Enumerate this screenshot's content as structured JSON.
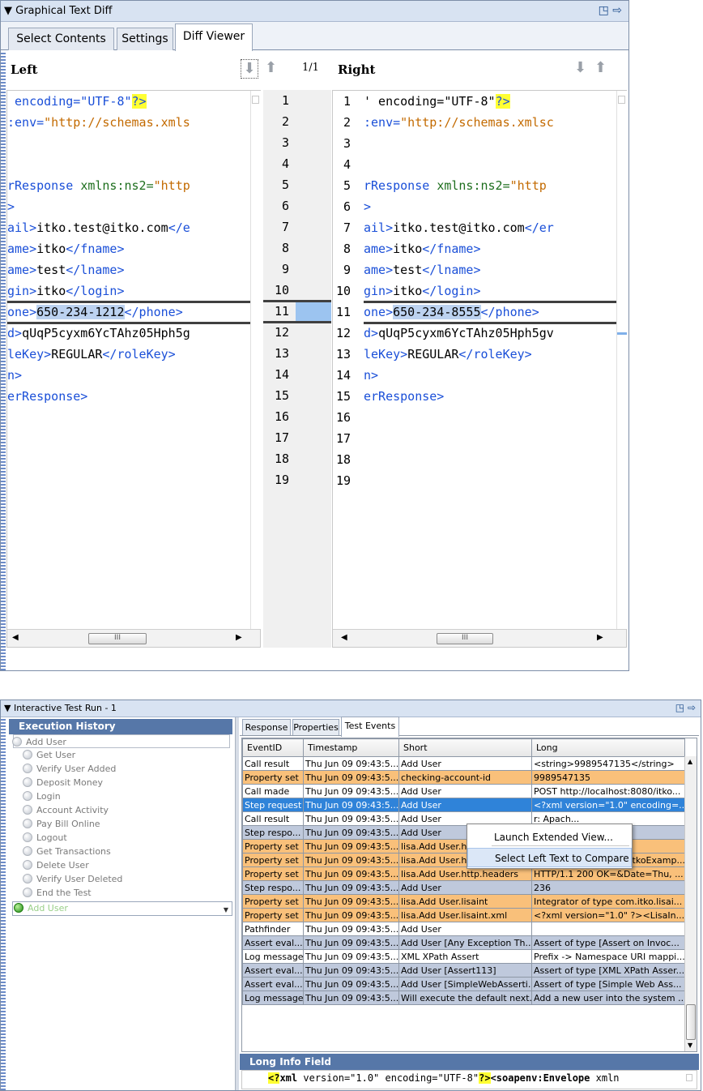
{
  "top_panel": {
    "title": "▼ Graphical Text Diff",
    "tabs": [
      "Select Contents",
      "Settings",
      "Diff Viewer"
    ],
    "left_header": "Left",
    "right_header": "Right",
    "position": "1/1",
    "left_lines": [
      [
        [
          "t",
          " encoding=\"UTF-8\""
        ],
        [
          "h",
          "?>"
        ]
      ],
      [
        [
          "t",
          ":env="
        ],
        [
          "s",
          "\"http://schemas.xmls"
        ]
      ],
      [],
      [],
      [
        [
          "t",
          "rResponse "
        ],
        [
          "a",
          "xmlns:ns2="
        ],
        [
          "s",
          "\"http"
        ]
      ],
      [
        [
          "t",
          ">"
        ]
      ],
      [
        [
          "t",
          "ail>"
        ],
        [
          "k",
          "itko.test@itko.com"
        ],
        [
          "t",
          "</e"
        ]
      ],
      [
        [
          "t",
          "ame>"
        ],
        [
          "k",
          "itko"
        ],
        [
          "t",
          "</fname>"
        ]
      ],
      [
        [
          "t",
          "ame>"
        ],
        [
          "k",
          "test"
        ],
        [
          "t",
          "</lname>"
        ]
      ],
      [
        [
          "t",
          "gin>"
        ],
        [
          "k",
          "itko"
        ],
        [
          "t",
          "</login>"
        ]
      ],
      [
        [
          "t",
          "one>"
        ],
        [
          "d",
          "650-234-1212"
        ],
        [
          "t",
          "</phone>"
        ]
      ],
      [
        [
          "t",
          "d>"
        ],
        [
          "k",
          "qUqP5cyxm6YcTAhz05Hph5g"
        ]
      ],
      [
        [
          "t",
          "leKey>"
        ],
        [
          "k",
          "REGULAR"
        ],
        [
          "t",
          "</roleKey>"
        ]
      ],
      [
        [
          "t",
          "n>"
        ]
      ],
      [
        [
          "t",
          "erResponse>"
        ]
      ],
      [],
      [],
      [],
      []
    ],
    "right_lines": [
      [
        [
          "k",
          "' encoding=\"UTF-8\""
        ],
        [
          "h",
          "?>"
        ]
      ],
      [
        [
          "t",
          ":env="
        ],
        [
          "s",
          "\"http://schemas.xmlsc"
        ]
      ],
      [],
      [],
      [
        [
          "t",
          "rResponse "
        ],
        [
          "a",
          "xmlns:ns2="
        ],
        [
          "s",
          "\"http"
        ]
      ],
      [
        [
          "t",
          ">"
        ]
      ],
      [
        [
          "t",
          "ail>"
        ],
        [
          "k",
          "itko.test@itko.com"
        ],
        [
          "t",
          "</er"
        ]
      ],
      [
        [
          "t",
          "ame>"
        ],
        [
          "k",
          "itko"
        ],
        [
          "t",
          "</fname>"
        ]
      ],
      [
        [
          "t",
          "ame>"
        ],
        [
          "k",
          "test"
        ],
        [
          "t",
          "</lname>"
        ]
      ],
      [
        [
          "t",
          "gin>"
        ],
        [
          "k",
          "itko"
        ],
        [
          "t",
          "</login>"
        ]
      ],
      [
        [
          "t",
          "one>"
        ],
        [
          "d",
          "650-234-8555"
        ],
        [
          "t",
          "</phone>"
        ]
      ],
      [
        [
          "t",
          "d>"
        ],
        [
          "k",
          "qUqP5cyxm6YcTAhz05Hph5gv"
        ]
      ],
      [
        [
          "t",
          "leKey>"
        ],
        [
          "k",
          "REGULAR"
        ],
        [
          "t",
          "</roleKey>"
        ]
      ],
      [
        [
          "t",
          "n>"
        ]
      ],
      [
        [
          "t",
          "erResponse>"
        ]
      ],
      [],
      [],
      [],
      []
    ],
    "line_numbers": [
      "1",
      "2",
      "3",
      "4",
      "5",
      "6",
      "7",
      "8",
      "9",
      "10",
      "11",
      "12",
      "13",
      "14",
      "15",
      "16",
      "17",
      "18",
      "19"
    ],
    "scroll_thumb": "III"
  },
  "bottom_panel": {
    "title": "▼ Interactive Test Run - 1",
    "execution_history_title": "Execution History",
    "steps": [
      "Add User",
      "Get User",
      "Verify User Added",
      "Deposit Money",
      "Login",
      "Account Activity",
      "Pay Bill Online",
      "Logout",
      "Get Transactions",
      "Delete User",
      "Verify User Deleted",
      "End the Test"
    ],
    "current_step": "Add User",
    "tabs": [
      "Response",
      "Properties",
      "Test Events"
    ],
    "columns": [
      "EventID",
      "Timestamp",
      "Short",
      "Long"
    ],
    "rows": [
      {
        "style": "white",
        "cells": [
          "Call result",
          "Thu Jun 09 09:43:5...",
          "Add User",
          "<string>9989547135</string>"
        ]
      },
      {
        "style": "orange",
        "cells": [
          "Property set",
          "Thu Jun 09 09:43:5...",
          "checking-account-id",
          "9989547135"
        ]
      },
      {
        "style": "white",
        "cells": [
          "Call made",
          "Thu Jun 09 09:43:5...",
          "Add User",
          "POST http://localhost:8080/itko..."
        ]
      },
      {
        "style": "sel",
        "cells": [
          "Step request",
          "Thu Jun 09 09:43:5...",
          "Add User",
          "<?xml version=\"1.0\" encoding=..."
        ]
      },
      {
        "style": "white",
        "cells": [
          "Call result",
          "Thu Jun 09 09:43:5...",
          "Add User",
          "r: Apach..."
        ]
      },
      {
        "style": "blue",
        "cells": [
          "Step respo...",
          "Thu Jun 09 09:43:5...",
          "Add User",
          "env='htt..."
        ]
      },
      {
        "style": "orange",
        "cells": [
          "Property set",
          "Thu Jun 09 09:43:5...",
          "lisa.Add User.h",
          ""
        ]
      },
      {
        "style": "orange",
        "cells": [
          "Property set",
          "Thu Jun 09 09:43:5...",
          "lisa.Add User.http.requestURL",
          "http://localhost:8080/itkoExamp..."
        ]
      },
      {
        "style": "orange",
        "cells": [
          "Property set",
          "Thu Jun 09 09:43:5...",
          "lisa.Add User.http.headers",
          "HTTP/1.1 200 OK=&Date=Thu, ..."
        ]
      },
      {
        "style": "blue",
        "cells": [
          "Step respo...",
          "Thu Jun 09 09:43:5...",
          "Add User",
          "236"
        ]
      },
      {
        "style": "orange",
        "cells": [
          "Property set",
          "Thu Jun 09 09:43:5...",
          "lisa.Add User.lisaint",
          "Integrator of type com.itko.lisai..."
        ]
      },
      {
        "style": "orange",
        "cells": [
          "Property set",
          "Thu Jun 09 09:43:5...",
          "lisa.Add User.lisaint.xml",
          " <?xml version=\"1.0\" ?><LisaIn..."
        ]
      },
      {
        "style": "white",
        "cells": [
          "Pathfinder",
          "Thu Jun 09 09:43:5...",
          "Add User",
          ""
        ]
      },
      {
        "style": "blue",
        "cells": [
          "Assert eval...",
          "Thu Jun 09 09:43:5...",
          "Add User [Any Exception Th...",
          "Assert of type [Assert on Invoc..."
        ]
      },
      {
        "style": "white",
        "cells": [
          "Log message",
          "Thu Jun 09 09:43:5...",
          "XML XPath Assert",
          "Prefix -> Namespace URI mappi..."
        ]
      },
      {
        "style": "blue",
        "cells": [
          "Assert eval...",
          "Thu Jun 09 09:43:5...",
          "Add User [Assert113]",
          "Assert of type [XML XPath Asser..."
        ]
      },
      {
        "style": "blue",
        "cells": [
          "Assert eval...",
          "Thu Jun 09 09:43:5...",
          "Add User [SimpleWebAsserti...",
          "Assert of type [Simple Web Ass..."
        ]
      },
      {
        "style": "blue",
        "cells": [
          "Log message",
          "Thu Jun 09 09:43:5...",
          "Will execute the default next...",
          "Add a new user into the system ..."
        ]
      }
    ],
    "context_menu": [
      "Launch Extended View...",
      "Select Left Text to Compare"
    ],
    "long_info_title": "Long Info Field",
    "long_info": [
      [
        "h",
        "<?"
      ],
      [
        "t",
        "xml"
      ],
      [
        "p",
        " version=\"1.0\" encoding=\"UTF-8\""
      ],
      [
        "h",
        "?>"
      ],
      [
        "t",
        "<soapenv:Envelope"
      ],
      [
        "p",
        " xmln"
      ]
    ]
  }
}
